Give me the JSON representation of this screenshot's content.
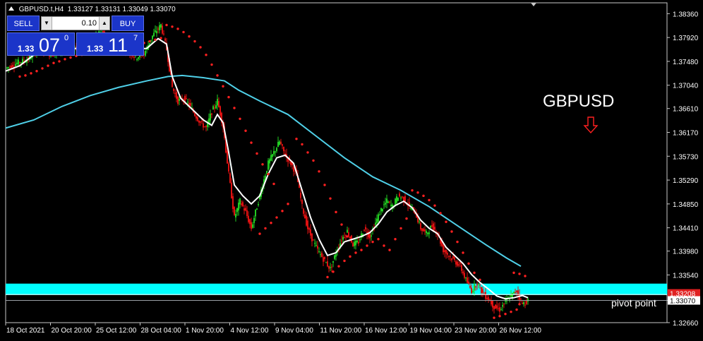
{
  "title_bar": {
    "symbol": "GBPUSD.t,H4",
    "ohlc": "1.33127 1.33131 1.33049 1.33070"
  },
  "trade_panel": {
    "sell_label": "SELL",
    "buy_label": "BUY",
    "lot_value": "0.10",
    "sell_price_prefix": "1.33",
    "sell_price_big": "07",
    "sell_price_sup": "0",
    "buy_price_prefix": "1.33",
    "buy_price_big": "11",
    "buy_price_sup": "7"
  },
  "annotations": {
    "symbol_label": "GBPUSD",
    "pivot_label": "pivot point",
    "arrow_color": "#ff2020"
  },
  "colors": {
    "background": "#000000",
    "bull": "#22cc22",
    "bear": "#dd1111",
    "ma_slow": "#4fd0e8",
    "ma_fast": "#ffffff",
    "psar": "#ff2020",
    "pivot_zone": "#00ffff",
    "price_tag": "#e02020"
  },
  "chart_data": {
    "type": "candlestick",
    "symbol": "GBPUSD",
    "timeframe": "H4",
    "ylim": [
      1.3266,
      1.3856
    ],
    "y_ticks": [
      "1.38360",
      "1.37920",
      "1.37480",
      "1.37040",
      "1.36610",
      "1.36170",
      "1.35730",
      "1.35290",
      "1.34850",
      "1.34410",
      "1.33980",
      "1.33540",
      "1.33070",
      "1.32660"
    ],
    "x_labels": [
      "18 Oct 2021",
      "20 Oct 20:00",
      "25 Oct 12:00",
      "28 Oct 04:00",
      "1 Nov 20:00",
      "4 Nov 12:00",
      "9 Nov 04:00",
      "11 Nov 20:00",
      "16 Nov 12:00",
      "19 Nov 04:00",
      "23 Nov 20:00",
      "26 Nov 12:00"
    ],
    "close_path": [
      [
        0,
        1.3735
      ],
      [
        8,
        1.3745
      ],
      [
        16,
        1.3752
      ],
      [
        24,
        1.3772
      ],
      [
        32,
        1.376
      ],
      [
        40,
        1.3768
      ],
      [
        48,
        1.3775
      ],
      [
        56,
        1.3768
      ],
      [
        62,
        1.379
      ],
      [
        68,
        1.3806
      ],
      [
        74,
        1.3766
      ],
      [
        80,
        1.379
      ],
      [
        86,
        1.377
      ],
      [
        92,
        1.3755
      ],
      [
        98,
        1.3762
      ],
      [
        104,
        1.3795
      ],
      [
        110,
        1.3815
      ],
      [
        114,
        1.377
      ],
      [
        118,
        1.37
      ],
      [
        122,
        1.3675
      ],
      [
        126,
        1.368
      ],
      [
        130,
        1.3668
      ],
      [
        134,
        1.365
      ],
      [
        138,
        1.3635
      ],
      [
        142,
        1.3625
      ],
      [
        146,
        1.3655
      ],
      [
        150,
        1.3675
      ],
      [
        154,
        1.3628
      ],
      [
        158,
        1.354
      ],
      [
        162,
        1.346
      ],
      [
        166,
        1.349
      ],
      [
        170,
        1.347
      ],
      [
        174,
        1.344
      ],
      [
        178,
        1.348
      ],
      [
        182,
        1.352
      ],
      [
        186,
        1.356
      ],
      [
        190,
        1.358
      ],
      [
        194,
        1.36
      ],
      [
        198,
        1.3575
      ],
      [
        202,
        1.356
      ],
      [
        206,
        1.354
      ],
      [
        210,
        1.348
      ],
      [
        214,
        1.344
      ],
      [
        218,
        1.3415
      ],
      [
        222,
        1.3395
      ],
      [
        226,
        1.338
      ],
      [
        230,
        1.3365
      ],
      [
        234,
        1.3395
      ],
      [
        238,
        1.342
      ],
      [
        242,
        1.3435
      ],
      [
        246,
        1.341
      ],
      [
        250,
        1.3415
      ],
      [
        254,
        1.344
      ],
      [
        258,
        1.3425
      ],
      [
        262,
        1.345
      ],
      [
        266,
        1.3475
      ],
      [
        270,
        1.349
      ],
      [
        274,
        1.348
      ],
      [
        278,
        1.35
      ],
      [
        282,
        1.3495
      ],
      [
        286,
        1.348
      ],
      [
        290,
        1.347
      ],
      [
        294,
        1.344
      ],
      [
        298,
        1.343
      ],
      [
        302,
        1.3445
      ],
      [
        306,
        1.343
      ],
      [
        310,
        1.34
      ],
      [
        314,
        1.339
      ],
      [
        318,
        1.338
      ],
      [
        322,
        1.337
      ],
      [
        326,
        1.3345
      ],
      [
        330,
        1.3325
      ],
      [
        334,
        1.334
      ],
      [
        338,
        1.332
      ],
      [
        342,
        1.331
      ],
      [
        346,
        1.3295
      ],
      [
        350,
        1.329
      ],
      [
        354,
        1.3305
      ],
      [
        358,
        1.3315
      ],
      [
        362,
        1.3325
      ],
      [
        366,
        1.33
      ],
      [
        370,
        1.3307
      ]
    ],
    "ma_fast_path": [
      [
        0,
        1.373
      ],
      [
        10,
        1.374
      ],
      [
        20,
        1.376
      ],
      [
        30,
        1.3765
      ],
      [
        40,
        1.3768
      ],
      [
        50,
        1.3772
      ],
      [
        60,
        1.3778
      ],
      [
        70,
        1.3782
      ],
      [
        80,
        1.378
      ],
      [
        90,
        1.377
      ],
      [
        100,
        1.3772
      ],
      [
        108,
        1.379
      ],
      [
        114,
        1.378
      ],
      [
        118,
        1.372
      ],
      [
        124,
        1.368
      ],
      [
        132,
        1.366
      ],
      [
        140,
        1.364
      ],
      [
        146,
        1.363
      ],
      [
        150,
        1.365
      ],
      [
        154,
        1.3635
      ],
      [
        158,
        1.358
      ],
      [
        162,
        1.352
      ],
      [
        168,
        1.35
      ],
      [
        174,
        1.3485
      ],
      [
        180,
        1.35
      ],
      [
        186,
        1.354
      ],
      [
        192,
        1.357
      ],
      [
        198,
        1.3575
      ],
      [
        204,
        1.356
      ],
      [
        210,
        1.351
      ],
      [
        216,
        1.346
      ],
      [
        222,
        1.342
      ],
      [
        228,
        1.339
      ],
      [
        234,
        1.3395
      ],
      [
        240,
        1.3415
      ],
      [
        246,
        1.342
      ],
      [
        252,
        1.3425
      ],
      [
        258,
        1.3432
      ],
      [
        264,
        1.3448
      ],
      [
        270,
        1.347
      ],
      [
        276,
        1.3482
      ],
      [
        282,
        1.349
      ],
      [
        288,
        1.3478
      ],
      [
        294,
        1.3455
      ],
      [
        300,
        1.344
      ],
      [
        306,
        1.343
      ],
      [
        312,
        1.3405
      ],
      [
        318,
        1.339
      ],
      [
        324,
        1.3375
      ],
      [
        330,
        1.3355
      ],
      [
        336,
        1.334
      ],
      [
        342,
        1.3328
      ],
      [
        348,
        1.3315
      ],
      [
        354,
        1.331
      ],
      [
        360,
        1.3312
      ],
      [
        366,
        1.3316
      ],
      [
        370,
        1.3312
      ]
    ],
    "ma_slow_path": [
      [
        0,
        1.3625
      ],
      [
        20,
        1.364
      ],
      [
        40,
        1.3665
      ],
      [
        60,
        1.3685
      ],
      [
        80,
        1.37
      ],
      [
        100,
        1.3712
      ],
      [
        115,
        1.372
      ],
      [
        125,
        1.3722
      ],
      [
        140,
        1.3718
      ],
      [
        155,
        1.3712
      ],
      [
        165,
        1.3695
      ],
      [
        180,
        1.3675
      ],
      [
        200,
        1.365
      ],
      [
        220,
        1.361
      ],
      [
        240,
        1.357
      ],
      [
        260,
        1.3535
      ],
      [
        280,
        1.351
      ],
      [
        300,
        1.348
      ],
      [
        320,
        1.3445
      ],
      [
        340,
        1.341
      ],
      [
        355,
        1.3385
      ],
      [
        365,
        1.337
      ]
    ],
    "psar_segments": [
      {
        "dir": "below",
        "points": [
          [
            10,
            1.372
          ],
          [
            14,
            1.3722
          ],
          [
            18,
            1.3726
          ],
          [
            22,
            1.373
          ],
          [
            26,
            1.3735
          ],
          [
            30,
            1.374
          ],
          [
            34,
            1.3745
          ],
          [
            38,
            1.3748
          ],
          [
            42,
            1.3752
          ],
          [
            46,
            1.3755
          ],
          [
            50,
            1.3758
          ],
          [
            54,
            1.376
          ],
          [
            58,
            1.3762
          ],
          [
            62,
            1.3765
          ],
          [
            66,
            1.3768
          ],
          [
            70,
            1.377
          ],
          [
            74,
            1.3772
          ],
          [
            78,
            1.3773
          ],
          [
            82,
            1.3775
          ],
          [
            86,
            1.3776
          ],
          [
            90,
            1.3778
          ],
          [
            94,
            1.378
          ],
          [
            98,
            1.3782
          ],
          [
            102,
            1.3785
          ],
          [
            106,
            1.3788
          ],
          [
            110,
            1.3791
          ]
        ]
      },
      {
        "dir": "above",
        "points": [
          [
            114,
            1.3815
          ],
          [
            118,
            1.3812
          ],
          [
            122,
            1.3808
          ],
          [
            126,
            1.3802
          ],
          [
            130,
            1.3794
          ],
          [
            134,
            1.3785
          ],
          [
            138,
            1.3774
          ],
          [
            142,
            1.376
          ],
          [
            146,
            1.3742
          ],
          [
            150,
            1.3722
          ],
          [
            154,
            1.3702
          ],
          [
            158,
            1.3682
          ],
          [
            162,
            1.3662
          ],
          [
            166,
            1.3642
          ],
          [
            170,
            1.362
          ],
          [
            174,
            1.3598
          ],
          [
            178,
            1.3578
          ],
          [
            182,
            1.3558
          ],
          [
            186,
            1.354
          ],
          [
            190,
            1.3522
          ]
        ]
      },
      {
        "dir": "below",
        "points": [
          [
            180,
            1.343
          ],
          [
            184,
            1.344
          ],
          [
            188,
            1.345
          ],
          [
            192,
            1.346
          ],
          [
            196,
            1.3472
          ],
          [
            200,
            1.3485
          ]
        ]
      },
      {
        "dir": "above",
        "points": [
          [
            206,
            1.3605
          ],
          [
            210,
            1.3595
          ],
          [
            214,
            1.358
          ],
          [
            218,
            1.3565
          ],
          [
            222,
            1.3545
          ],
          [
            226,
            1.352
          ],
          [
            230,
            1.3495
          ],
          [
            234,
            1.347
          ],
          [
            238,
            1.3447
          ],
          [
            242,
            1.3425
          ]
        ]
      },
      {
        "dir": "below",
        "points": [
          [
            228,
            1.335
          ],
          [
            232,
            1.336
          ],
          [
            236,
            1.337
          ],
          [
            240,
            1.338
          ],
          [
            244,
            1.3388
          ],
          [
            248,
            1.3395
          ],
          [
            252,
            1.34
          ],
          [
            256,
            1.3408
          ],
          [
            260,
            1.3415
          ],
          [
            264,
            1.342
          ],
          [
            268,
            1.3408
          ],
          [
            272,
            1.34
          ],
          [
            276,
            1.342
          ],
          [
            280,
            1.344
          ],
          [
            284,
            1.3458
          ]
        ]
      },
      {
        "dir": "above",
        "points": [
          [
            288,
            1.351
          ],
          [
            292,
            1.3506
          ],
          [
            296,
            1.35
          ],
          [
            300,
            1.3492
          ],
          [
            304,
            1.3482
          ],
          [
            308,
            1.3468
          ],
          [
            312,
            1.3452
          ],
          [
            316,
            1.3434
          ],
          [
            320,
            1.3415
          ],
          [
            324,
            1.3395
          ],
          [
            328,
            1.3375
          ],
          [
            332,
            1.3358
          ],
          [
            336,
            1.3345
          ]
        ]
      },
      {
        "dir": "below",
        "points": [
          [
            346,
            1.3275
          ],
          [
            350,
            1.3278
          ],
          [
            354,
            1.3282
          ],
          [
            358,
            1.3286
          ],
          [
            362,
            1.329
          ],
          [
            364,
            1.33
          ]
        ]
      },
      {
        "dir": "above",
        "points": [
          [
            360,
            1.3358
          ],
          [
            364,
            1.3356
          ],
          [
            368,
            1.3352
          ]
        ]
      }
    ],
    "pivot_zone": [
      1.3317,
      1.3338
    ],
    "pivot_line": 1.3318,
    "current_price_line": 1.3307,
    "price_tags": [
      {
        "label": "1.33208",
        "value": 1.332,
        "color": "#e02020"
      },
      {
        "label": "1.33070",
        "value": 1.3307,
        "color": "#ffffff"
      }
    ],
    "annotation_arrow": "down"
  }
}
